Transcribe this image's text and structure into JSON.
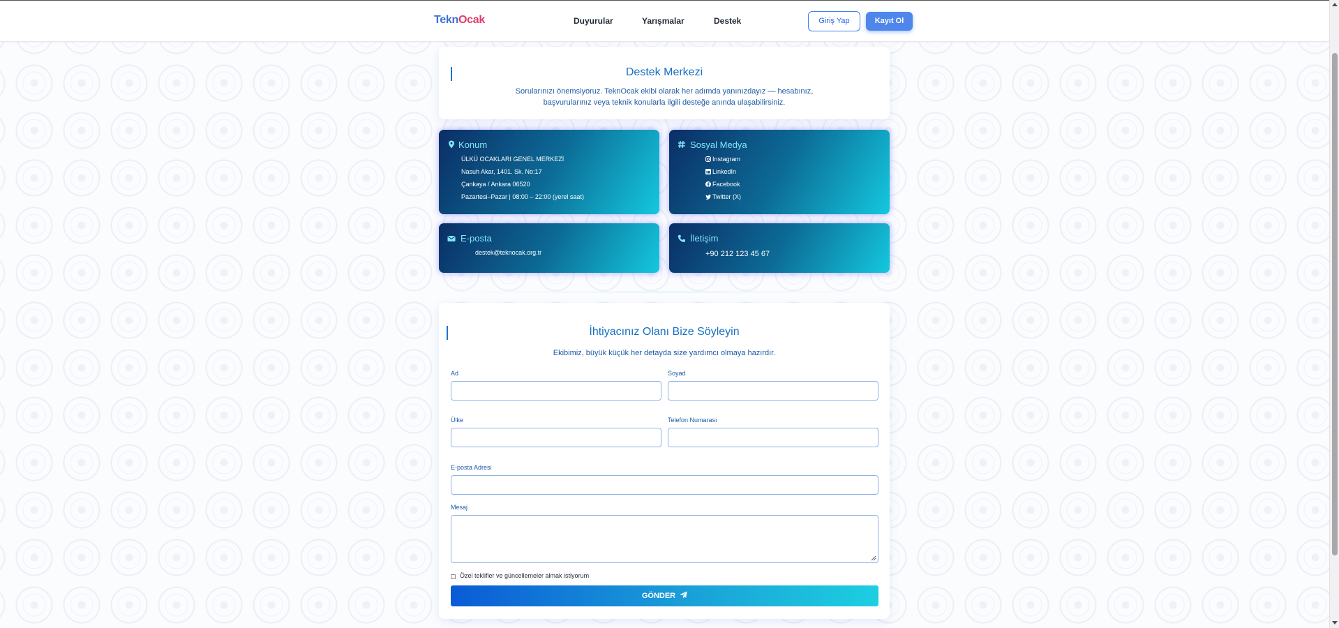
{
  "header": {
    "logo_part1": "Tekn",
    "logo_part2": "O",
    "logo_part3": "cak",
    "nav": [
      "Duyurular",
      "Yarışmalar",
      "Destek"
    ],
    "login_label": "Giriş Yap",
    "register_label": "Kayıt Ol"
  },
  "support": {
    "title": "Destek Merkezi",
    "desc_line1": "Sorularınızı önemsiyoruz. TeknOcak ekibi olarak her adımda yanınızdayız — hesabınız,",
    "desc_line2": "başvurularınız veya teknik konularla ilgili desteğe anında ulaşabilirsiniz."
  },
  "location": {
    "title": "Konum",
    "lines": [
      "ÜLKÜ OCAKLARI GENEL MERKEZİ",
      "Nasuh Akar, 1401. Sk. No:17",
      "Çankaya / Ankara 06520",
      "Pazartesi–Pazar | 08:00 – 22:00 (yerel saat)"
    ]
  },
  "social": {
    "title": "Sosyal Medya",
    "items": [
      "Instagram",
      "LinkedIn",
      "Facebook",
      "Twitter (X)"
    ]
  },
  "email_card": {
    "title": "E-posta",
    "value": "destek@teknocak.org.tr"
  },
  "contact_card": {
    "title": "İletişim",
    "value": "+90 212 123 45 67"
  },
  "form": {
    "title": "İhtiyacınız Olanı Bize Söyleyin",
    "subtitle": "Ekibimiz, büyük küçük her detayda size yardımcı olmaya hazırdır.",
    "first_name_label": "Ad",
    "last_name_label": "Soyad",
    "country_label": "Ülke",
    "phone_label": "Telefon Numarası",
    "email_label": "E-posta Adresi",
    "message_label": "Mesaj",
    "first_name_value": "",
    "last_name_value": "",
    "country_value": "",
    "phone_value": "",
    "email_value": "",
    "message_value": "",
    "optin_label": "Özel teklifler ve güncellemeler almak istiyorum",
    "submit_label": "GÖNDER"
  },
  "colors": {
    "accent": "#1570c4",
    "card_gradient_start": "#0b2e66",
    "card_gradient_end": "#14c8de",
    "button_blue": "#4f86ec"
  }
}
